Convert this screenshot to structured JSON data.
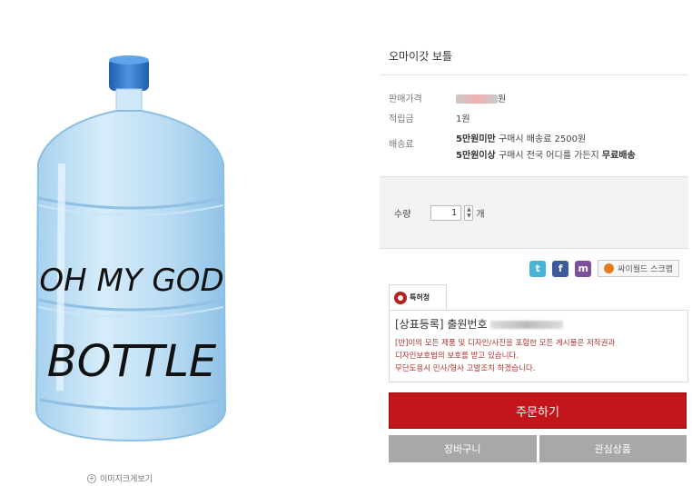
{
  "product": {
    "title": "오마이갓 보틀",
    "image_text_line1": "OH MY GOD",
    "image_text_line2": "BOTTLE"
  },
  "info": {
    "price_label": "판매가격",
    "price_suffix": "원",
    "points_label": "적립금",
    "points_value": "1원",
    "shipping_label": "배송료",
    "shipping_line1_bold": "5만원미만",
    "shipping_line1_rest": "구매시 배송료 2500원",
    "shipping_line2_bold": "5만원이상",
    "shipping_line2_rest": "구매시 전국 어디를 가든지",
    "shipping_line2_free": "무료배송"
  },
  "quantity": {
    "label": "수량",
    "value": "1",
    "unit": "개"
  },
  "social": {
    "twitter": "t",
    "facebook": "f",
    "me2day": "m",
    "cyworld": "싸이월드 스크랩"
  },
  "notice": {
    "logo_text": "특허청",
    "head_prefix": "[상표등록] 출원번호",
    "text_line1": "[반]이의 모든 제품 및 디자인/사진을 포함한 모든 게시물은 저작권과",
    "text_line2": "디자인보호법의 보호를 받고 있습니다.",
    "text_line3": "무단도용시 민사/형사 고발조치 하겠습니다."
  },
  "buttons": {
    "order": "주문하기",
    "cart": "장바구니",
    "wishlist": "관심상품",
    "zoom": "이미지크게보기"
  },
  "colors": {
    "order_button": "#c3151c",
    "sub_button": "#a8a8a8",
    "bottle_body": "#b8dcf3",
    "bottle_cap": "#2b78c9"
  }
}
